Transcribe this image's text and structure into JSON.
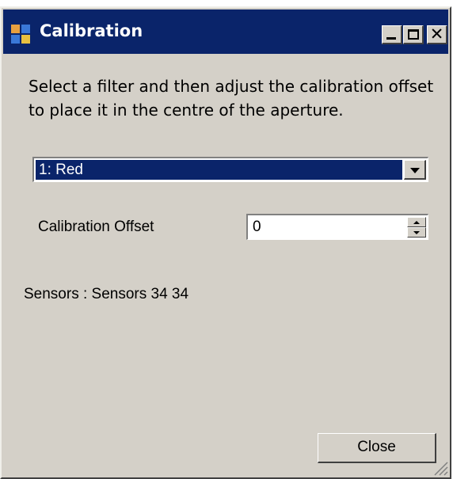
{
  "window": {
    "title": "Calibration",
    "icon": "app-grid-icon",
    "title_bar_color": "#0a246a",
    "controls": {
      "minimize": "minimize-icon",
      "maximize": "maximize-icon",
      "close": "✕"
    }
  },
  "instructions": "Select a filter and then adjust the calibration offset to place it in the centre of the aperture.",
  "filter_select": {
    "selected": "1: Red",
    "icon": "chevron-down-icon"
  },
  "calibration_offset": {
    "label": "Calibration Offset",
    "value": "0"
  },
  "sensors_text": "Sensors : Sensors 34 34",
  "buttons": {
    "close_label": "Close"
  }
}
